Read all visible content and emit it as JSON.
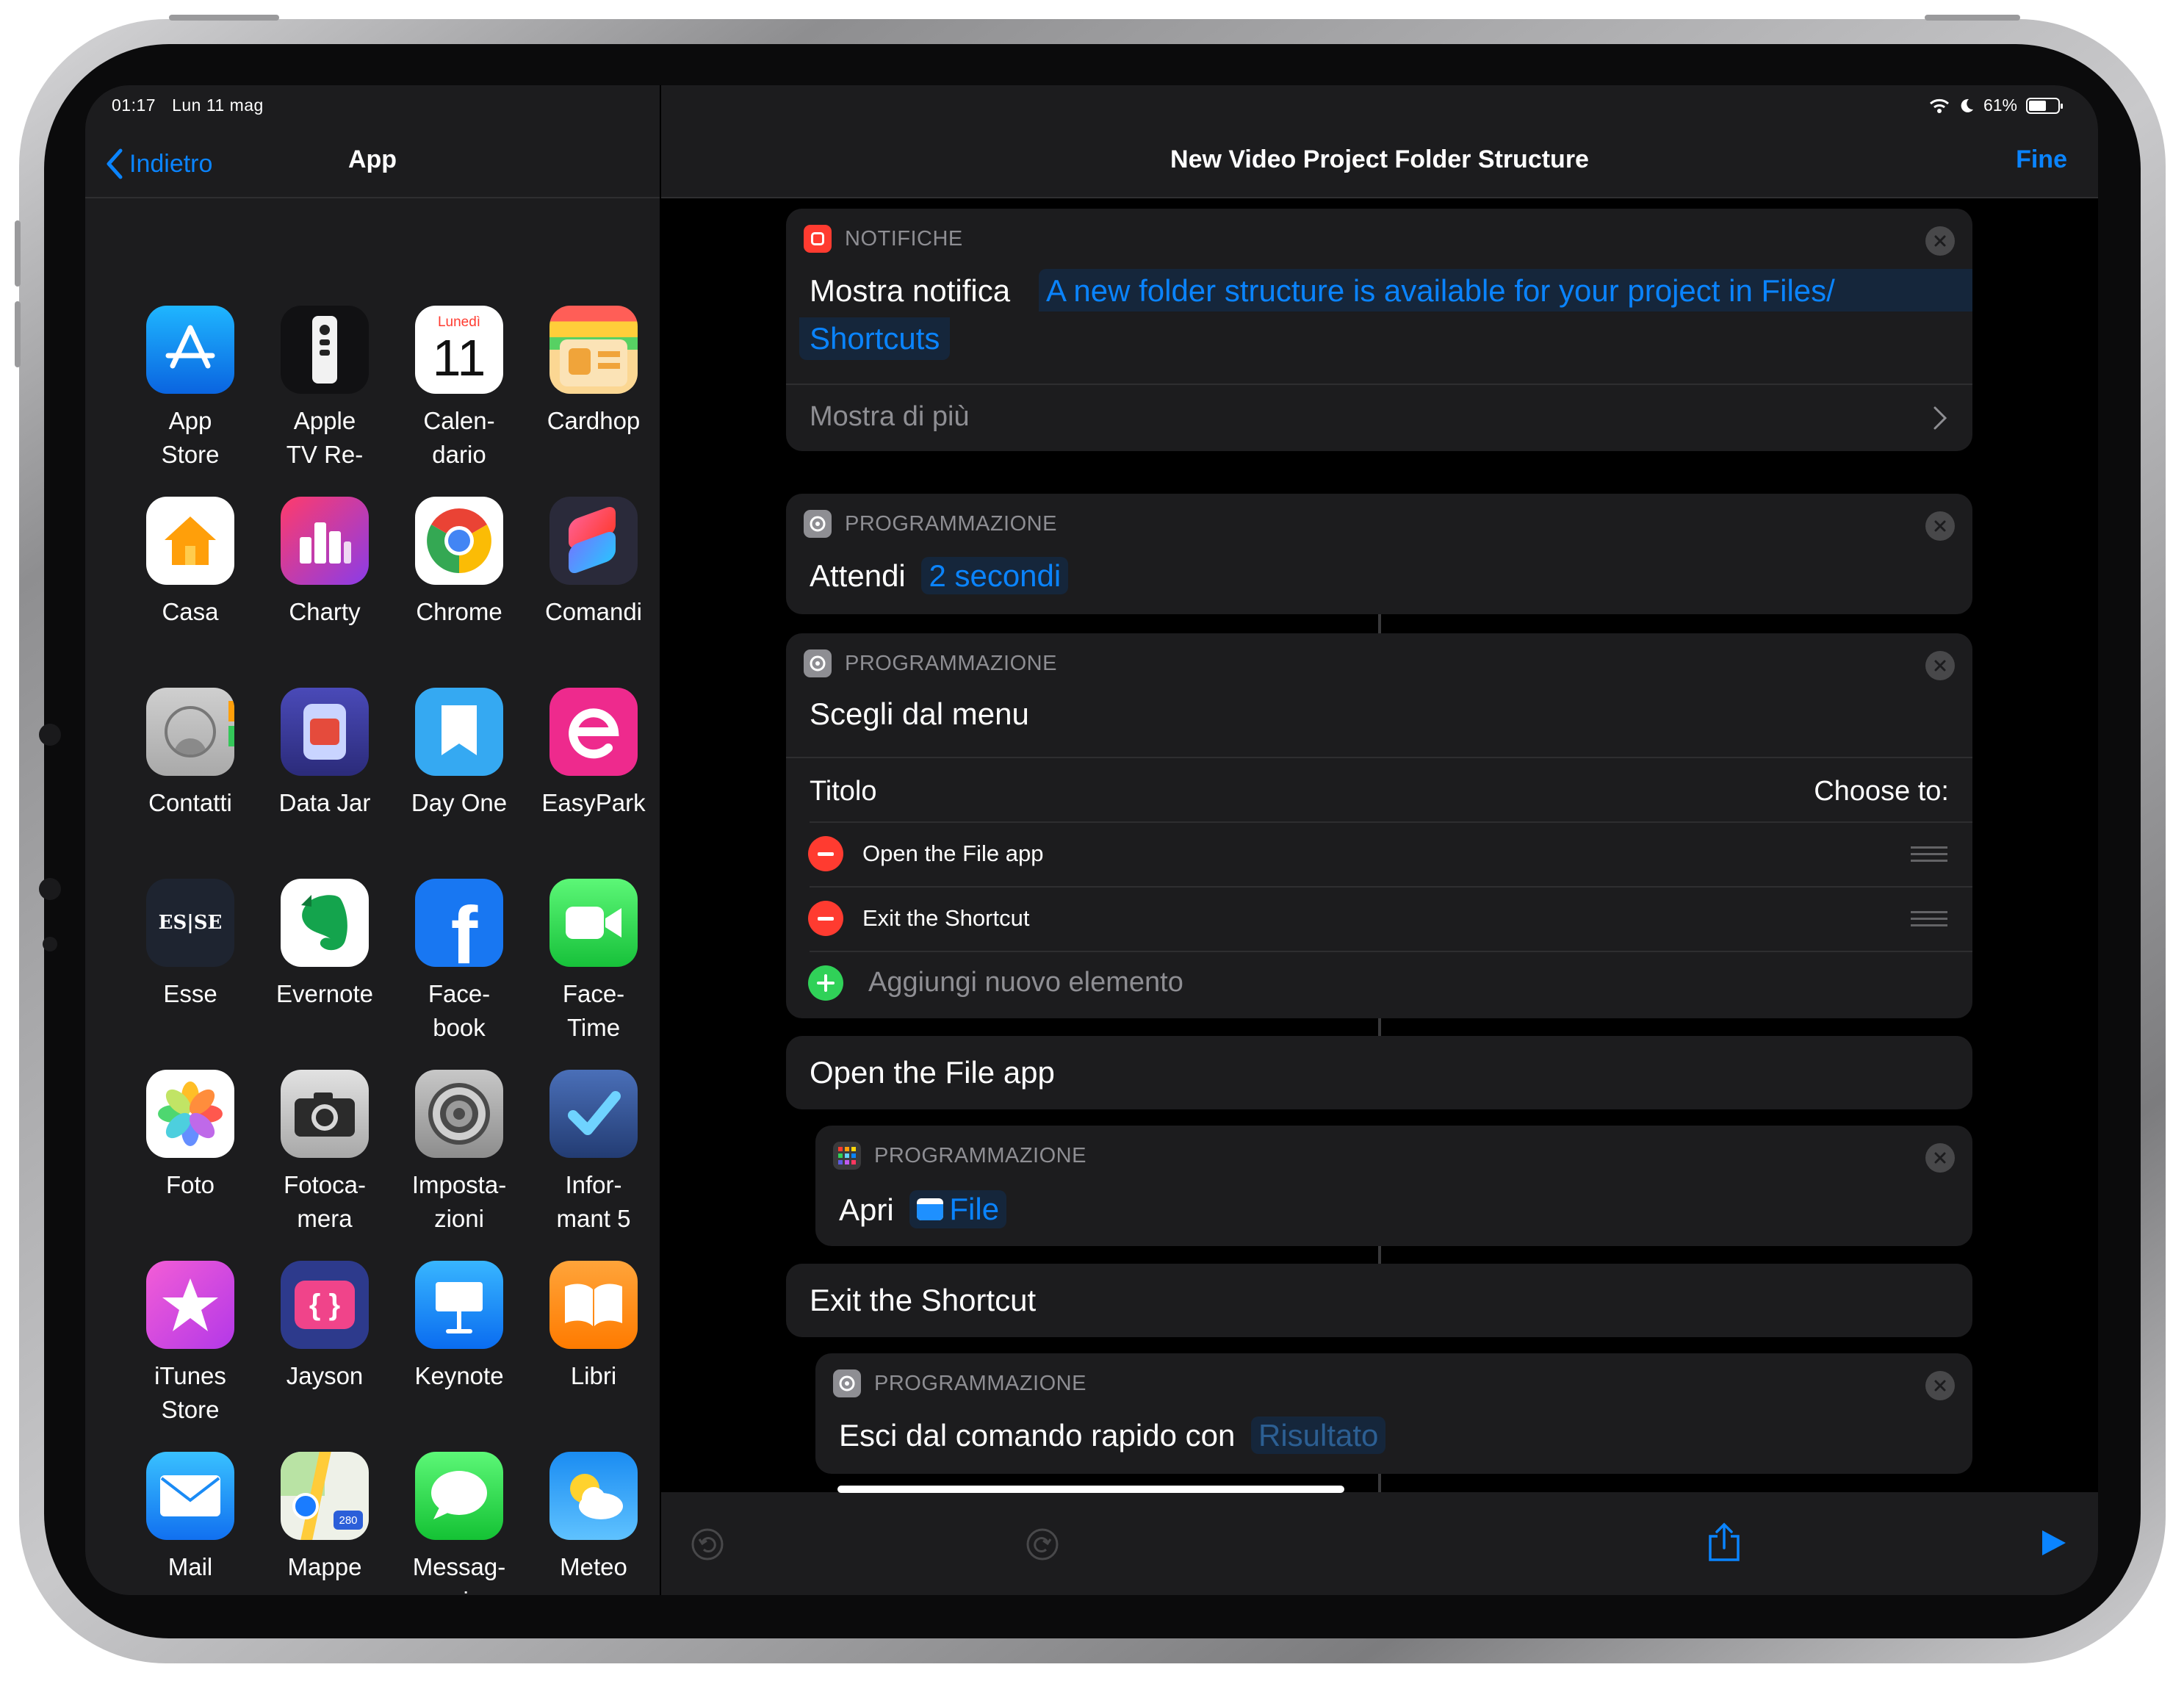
{
  "status_bar": {
    "time": "01:17",
    "date": "Lun 11 mag",
    "battery": "61%"
  },
  "left_panel": {
    "back_label": "Indietro",
    "title": "App",
    "apps": [
      {
        "label": "App\nStore",
        "icon": "app-store-icon"
      },
      {
        "label": "Apple\nTV Re-",
        "icon": "apple-tv-remote-icon"
      },
      {
        "label": "Calen-\ndario",
        "icon": "calendar-icon",
        "calendar_day": "Lunedì",
        "calendar_date": "11"
      },
      {
        "label": "Cardhop",
        "icon": "cardhop-icon"
      },
      {
        "label": "Casa",
        "icon": "home-icon"
      },
      {
        "label": "Charty",
        "icon": "charty-icon"
      },
      {
        "label": "Chrome",
        "icon": "chrome-icon"
      },
      {
        "label": "Comandi",
        "icon": "shortcuts-icon"
      },
      {
        "label": "Contatti",
        "icon": "contacts-icon"
      },
      {
        "label": "Data Jar",
        "icon": "data-jar-icon"
      },
      {
        "label": "Day One",
        "icon": "day-one-icon"
      },
      {
        "label": "EasyPark",
        "icon": "easypark-icon"
      },
      {
        "label": "Esse",
        "icon": "esse-icon",
        "logo_text": "ES|SE"
      },
      {
        "label": "Evernote",
        "icon": "evernote-icon"
      },
      {
        "label": "Face-\nbook",
        "icon": "facebook-icon"
      },
      {
        "label": "Face-\nTime",
        "icon": "facetime-icon"
      },
      {
        "label": "Foto",
        "icon": "photos-icon"
      },
      {
        "label": "Fotoca-\nmera",
        "icon": "camera-icon"
      },
      {
        "label": "Imposta-\nzioni",
        "icon": "settings-icon"
      },
      {
        "label": "Infor-\nmant 5",
        "icon": "informant-icon"
      },
      {
        "label": "iTunes\nStore",
        "icon": "itunes-store-icon"
      },
      {
        "label": "Jayson",
        "icon": "jayson-icon"
      },
      {
        "label": "Keynote",
        "icon": "keynote-icon"
      },
      {
        "label": "Libri",
        "icon": "books-icon"
      },
      {
        "label": "Mail",
        "icon": "mail-icon"
      },
      {
        "label": "Mappe",
        "icon": "maps-icon",
        "sign_text": "280"
      },
      {
        "label": "Messag-\ngi",
        "icon": "messages-icon"
      },
      {
        "label": "Meteo",
        "icon": "weather-icon"
      }
    ]
  },
  "editor": {
    "title": "New Video Project Folder Structure",
    "done_label": "Fine",
    "notification_card": {
      "category": "NOTIFICHE",
      "action": "Mostra notifica",
      "message_line1": "A new folder structure is available for your project in Files/",
      "message_line2": "Shortcuts",
      "show_more": "Mostra di più"
    },
    "wait_card": {
      "category": "PROGRAMMAZIONE",
      "action": "Attendi",
      "value": "2 secondi"
    },
    "menu_card": {
      "category": "PROGRAMMAZIONE",
      "action": "Scegli dal menu",
      "title_label": "Titolo",
      "title_value": "Choose to:",
      "items": [
        "Open the File app",
        "Exit the Shortcut"
      ],
      "add_item": "Aggiungi nuovo elemento"
    },
    "section_open": "Open the File app",
    "open_card": {
      "category": "PROGRAMMAZIONE",
      "action": "Apri",
      "app": "File"
    },
    "section_exit": "Exit the Shortcut",
    "exit_card": {
      "category": "PROGRAMMAZIONE",
      "action": "Esci dal comando rapido con",
      "value": "Risultato"
    }
  },
  "colors": {
    "accent": "#0a84ff",
    "background": "#000000",
    "card": "#1c1c1e"
  }
}
